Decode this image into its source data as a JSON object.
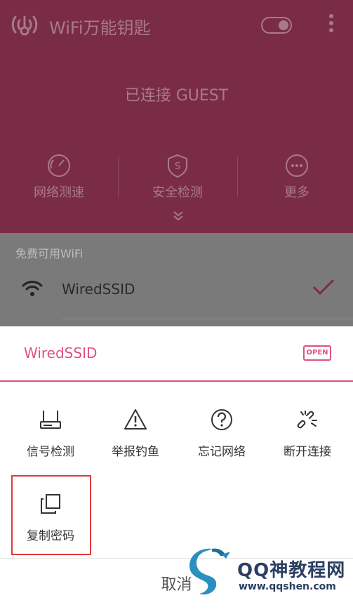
{
  "header": {
    "app_title": "WiFi万能钥匙",
    "status": "已连接 GUEST",
    "actions": [
      {
        "label": "网络测速",
        "icon": "speedometer-icon"
      },
      {
        "label": "安全检测",
        "icon": "shield-icon"
      },
      {
        "label": "更多",
        "icon": "more-circle-icon"
      }
    ]
  },
  "list": {
    "section_title": "免费可用WiFi",
    "networks": [
      {
        "ssid": "WiredSSID",
        "connected": true
      }
    ]
  },
  "sheet": {
    "ssid": "WiredSSID",
    "badge": "OPEN",
    "options": [
      {
        "label": "信号检测",
        "icon": "router-icon"
      },
      {
        "label": "举报钓鱼",
        "icon": "warning-icon"
      },
      {
        "label": "忘记网络",
        "icon": "question-icon"
      },
      {
        "label": "断开连接",
        "icon": "broken-link-icon"
      },
      {
        "label": "复制密码",
        "icon": "copy-icon"
      }
    ],
    "cancel": "取消"
  },
  "watermark": {
    "title": "QQ神教程网",
    "url": "www.qqshen.com"
  },
  "colors": {
    "accent": "#e0517c",
    "highlight": "#e23b3b"
  }
}
